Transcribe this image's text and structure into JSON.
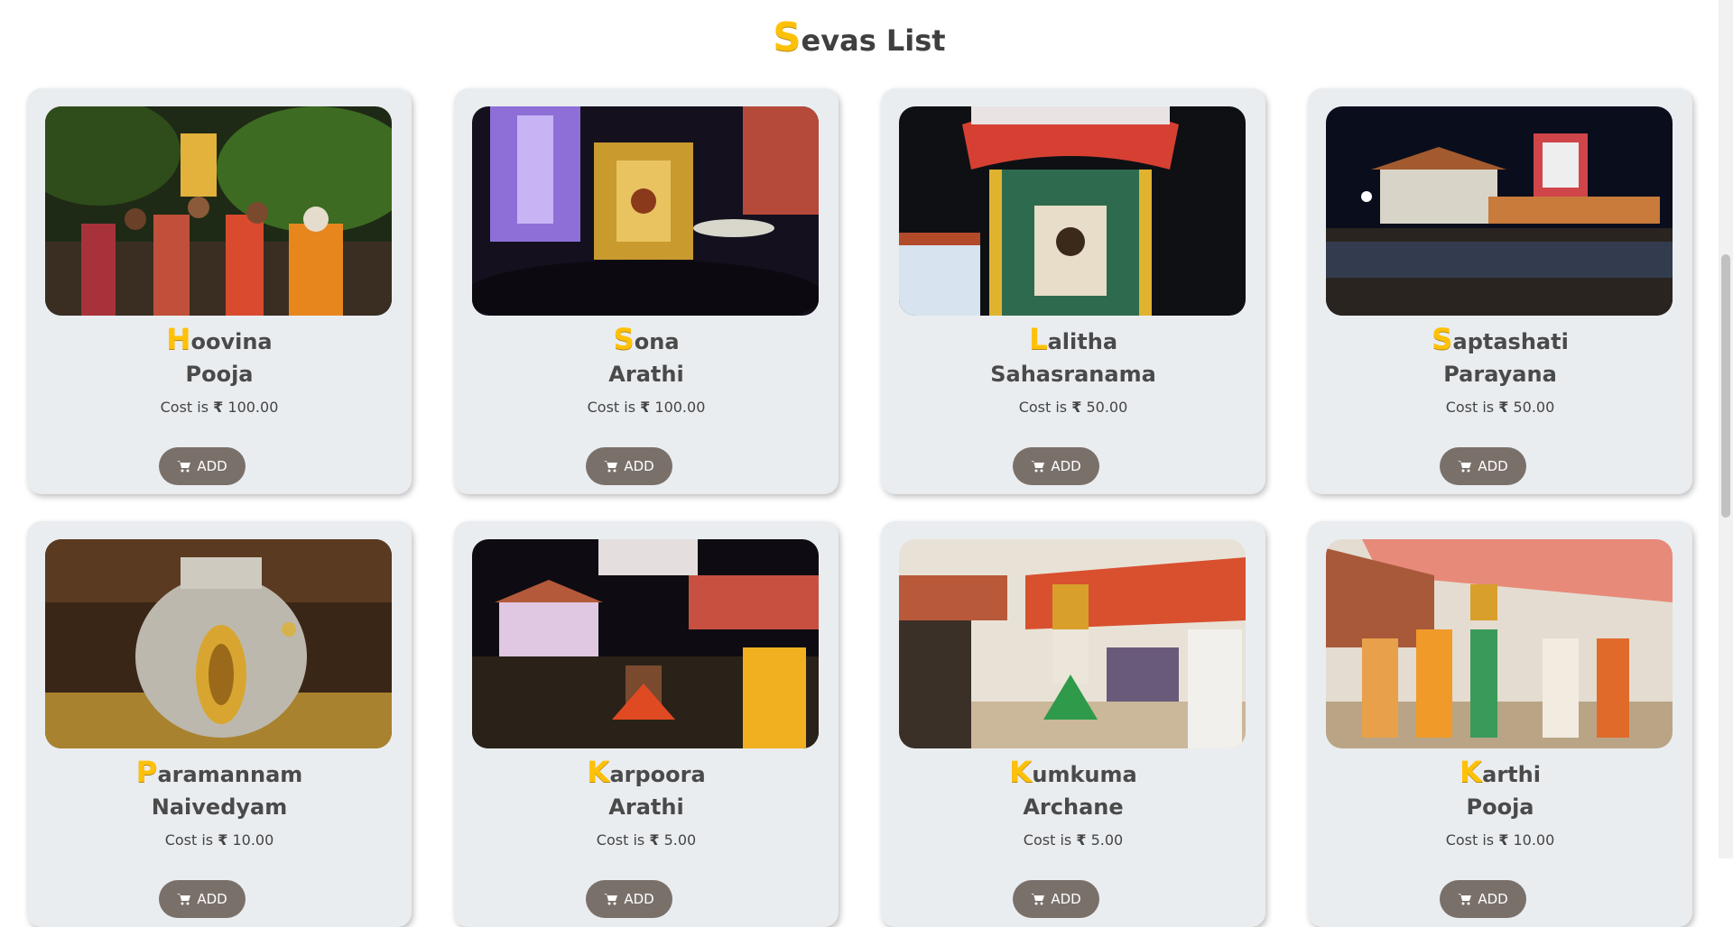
{
  "page": {
    "title_cap": "S",
    "title_rest": "evas List"
  },
  "sevas": [
    {
      "name_cap": "H",
      "name_rest": "oovina",
      "name_line2": "Pooja",
      "cost_prefix": "Cost is",
      "currency": "₹",
      "cost": "100.00",
      "add_label": "ADD",
      "image": "temple-procession-photo"
    },
    {
      "name_cap": "S",
      "name_rest": "ona",
      "name_line2": "Arathi",
      "cost_prefix": "Cost is",
      "currency": "₹",
      "cost": "100.00",
      "add_label": "ADD",
      "image": "golden-deity-arathi-photo"
    },
    {
      "name_cap": "L",
      "name_rest": "alitha",
      "name_line2": "Sahasranama",
      "cost_prefix": "Cost is",
      "currency": "₹",
      "cost": "50.00",
      "add_label": "ADD",
      "image": "decorated-chariot-photo"
    },
    {
      "name_cap": "S",
      "name_rest": "aptashati",
      "name_line2": "Parayana",
      "cost_prefix": "Cost is",
      "currency": "₹",
      "cost": "50.00",
      "add_label": "ADD",
      "image": "temple-night-crowd-photo"
    },
    {
      "name_cap": "P",
      "name_rest": "aramannam",
      "name_line2": "Naivedyam",
      "cost_prefix": "Cost is",
      "currency": "₹",
      "cost": "10.00",
      "add_label": "ADD",
      "image": "silver-vessel-deity-photo"
    },
    {
      "name_cap": "K",
      "name_rest": "arpoora",
      "name_line2": "Arathi",
      "cost_prefix": "Cost is",
      "currency": "₹",
      "cost": "5.00",
      "add_label": "ADD",
      "image": "night-dance-ritual-photo"
    },
    {
      "name_cap": "K",
      "name_rest": "umkuma",
      "name_line2": "Archane",
      "cost_prefix": "Cost is",
      "currency": "₹",
      "cost": "5.00",
      "add_label": "ADD",
      "image": "daytime-procession-photo"
    },
    {
      "name_cap": "K",
      "name_rest": "arthi",
      "name_line2": "Pooja",
      "cost_prefix": "Cost is",
      "currency": "₹",
      "cost": "10.00",
      "add_label": "ADD",
      "image": "canopy-procession-photo"
    }
  ],
  "colors": {
    "accent_yellow": "#ffc107",
    "card_bg": "#eaedf0",
    "button_bg": "#7a706a"
  },
  "icons": {
    "cart": "shopping-cart-icon"
  }
}
